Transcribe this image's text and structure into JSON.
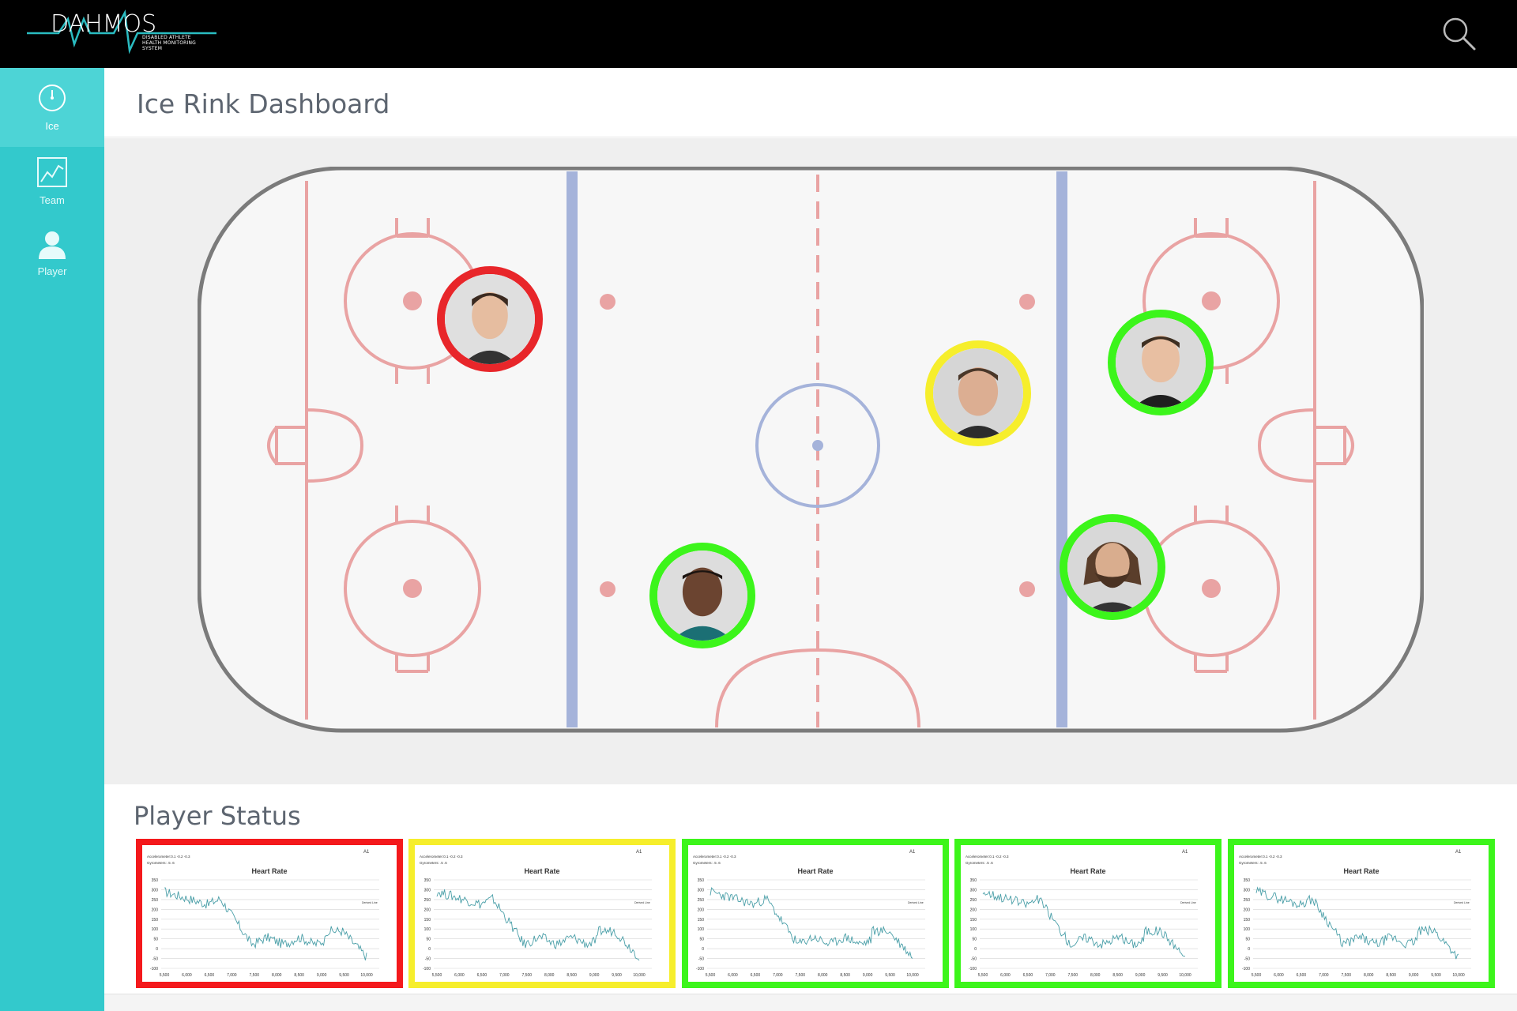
{
  "app": {
    "logo_text": "DAHMOS",
    "logo_subtitle": [
      "DISABLED ATHLETE",
      "HEALTH MONITORING",
      "SYSTEM"
    ]
  },
  "sidebar": {
    "items": [
      {
        "label": "Ice",
        "icon": "gauge-icon",
        "active": true
      },
      {
        "label": "Team",
        "icon": "line-chart-icon",
        "active": false
      },
      {
        "label": "Player",
        "icon": "person-icon",
        "active": false
      }
    ]
  },
  "header": {
    "title": "Ice Rink Dashboard"
  },
  "rink": {
    "players": [
      {
        "id": 1,
        "status": "critical",
        "ring_color": "#e8262a"
      },
      {
        "id": 2,
        "status": "warning",
        "ring_color": "#f6ee2c"
      },
      {
        "id": 3,
        "status": "ok",
        "ring_color": "#3cf51b"
      },
      {
        "id": 4,
        "status": "ok",
        "ring_color": "#3cf51b"
      },
      {
        "id": 5,
        "status": "ok",
        "ring_color": "#3cf51b"
      }
    ]
  },
  "player_status": {
    "title": "Player Status",
    "cards": [
      {
        "border": "#f4191c",
        "tag": "A1",
        "accel": "Accelerometer:0.1 -0.2 -0.3",
        "gyro": "Gyrometers: .5 .6",
        "chart_title": "Heart Rate",
        "legend": "Derived Line"
      },
      {
        "border": "#f6ee2c",
        "tag": "A1",
        "accel": "Accelerometer:0.1 -0.2 -0.3",
        "gyro": "Gyrometers: .5 .6",
        "chart_title": "Heart Rate",
        "legend": "Derived Line"
      },
      {
        "border": "#3cf51b",
        "tag": "A1",
        "accel": "Accelerometer:0.1 -0.2 -0.3",
        "gyro": "Gyrometers: .5 .6",
        "chart_title": "Heart Rate",
        "legend": "Derived Line"
      },
      {
        "border": "#3cf51b",
        "tag": "A1",
        "accel": "Accelerometer:0.1 -0.2 -0.3",
        "gyro": "Gyrometers: .5 .6",
        "chart_title": "Heart Rate",
        "legend": "Derived Line"
      },
      {
        "border": "#3cf51b",
        "tag": "A1",
        "accel": "Accelerometer:0.1 -0.2 -0.3",
        "gyro": "Gyrometers: .5 .6",
        "chart_title": "Heart Rate",
        "legend": "Derived Line"
      }
    ],
    "y_ticks": [
      "350",
      "300",
      "250",
      "200",
      "150",
      "100",
      "50",
      "0",
      "-50",
      "-100"
    ],
    "x_ticks": [
      "5,500",
      "6,000",
      "6,500",
      "7,000",
      "7,500",
      "8,000",
      "8,500",
      "9,000",
      "9,500",
      "10,000"
    ]
  },
  "colors": {
    "accent": "#33c9cc",
    "rink_red": "#e8a0a0",
    "rink_blue": "#a4b4d8",
    "line": "#4a9fa8"
  }
}
